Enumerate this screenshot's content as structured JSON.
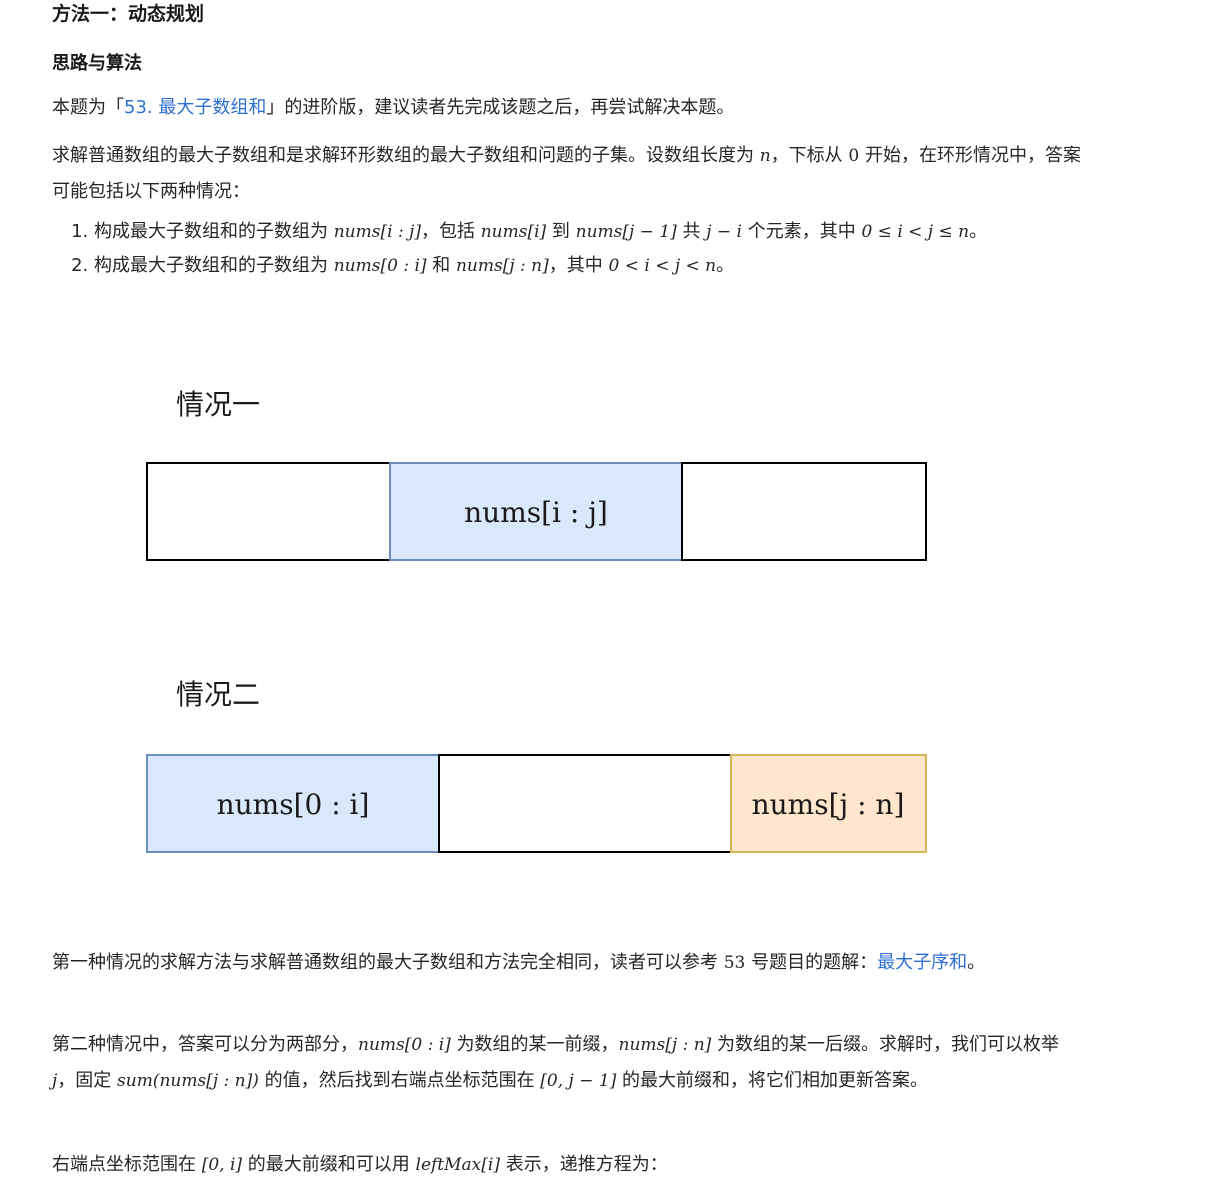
{
  "heading": "方法一：动态规划",
  "subheading": "思路与算法",
  "intro": {
    "before": "本题为「",
    "link": "53. 最大子数组和",
    "after": "」的进阶版，建议读者先完成该题之后，再尝试解决本题。"
  },
  "para1": {
    "text_a": "求解普通数组的最大子数组和是求解环形数组的最大子数组和问题的子集。设数组长度为 ",
    "math_n": "n",
    "text_b": "，下标从 ",
    "math_0": "0",
    "text_c": " 开始，在环形情况中，答案可能包括以下两种情况："
  },
  "list": [
    {
      "t1": "构成最大子数组和的子数组为 ",
      "m1": "nums[i : j]",
      "t2": "，包括 ",
      "m2": "nums[i]",
      "t3": " 到 ",
      "m3": "nums[j − 1]",
      "t4": " 共 ",
      "m4": "j − i",
      "t5": " 个元素，其中 ",
      "m5": "0 ≤ i < j ≤ n",
      "t6": "。"
    },
    {
      "t1": "构成最大子数组和的子数组为 ",
      "m1": "nums[0 : i]",
      "t2": " 和 ",
      "m2": "nums[j : n]",
      "t3": "，其中 ",
      "m3": "0 < i < j < n",
      "t4": "。"
    }
  ],
  "figure": {
    "case1_title": "情况一",
    "case1_mid_label": "nums[i : j]",
    "case2_title": "情况二",
    "case2_left_label": "nums[0 : i]",
    "case2_right_label": "nums[j : n]",
    "colors": {
      "blue_fill": "#dae8fc",
      "blue_stroke": "#6c8ebf",
      "orange_fill": "#ffe6cc",
      "orange_stroke": "#d6b656",
      "outline": "#000000"
    }
  },
  "para2": {
    "text_a": "第一种情况的求解方法与求解普通数组的最大子数组和方法完全相同，读者可以参考 ",
    "math_53": "53",
    "text_b": " 号题目的题解：",
    "link": "最大子序和",
    "text_c": "。"
  },
  "para3": {
    "t1": "第二种情况中，答案可以分为两部分，",
    "m1": "nums[0 : i]",
    "t2": " 为数组的某一前缀，",
    "m2": "nums[j : n]",
    "t3": " 为数组的某一后缀。求解时，我们可以枚举 ",
    "m3": "j",
    "t4": "，固定 ",
    "m4": "sum(nums[j : n])",
    "t5": " 的值，然后找到右端点坐标范围在 ",
    "m5": "[0, j − 1]",
    "t6": " 的最大前缀和，将它们相加更新答案。"
  },
  "para4": {
    "t1": "右端点坐标范围在 ",
    "m1": "[0, i]",
    "t2": " 的最大前缀和可以用 ",
    "m2": "leftMax[i]",
    "t3": " 表示，递推方程为："
  }
}
